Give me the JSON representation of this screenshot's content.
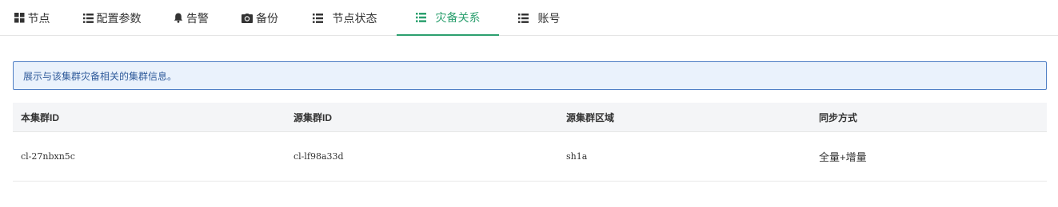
{
  "tabs": [
    {
      "label": "节点",
      "icon": "grid-icon"
    },
    {
      "label": "配置参数",
      "icon": "list-icon"
    },
    {
      "label": "告警",
      "icon": "bell-icon"
    },
    {
      "label": "备份",
      "icon": "camera-icon"
    },
    {
      "label": "节点状态",
      "icon": "list-icon"
    },
    {
      "label": "灾备关系",
      "icon": "list-icon",
      "active": true
    },
    {
      "label": "账号",
      "icon": "list-icon"
    }
  ],
  "alert": {
    "text": "展示与该集群灾备相关的集群信息。"
  },
  "table": {
    "columns": [
      "本集群ID",
      "源集群ID",
      "源集群区域",
      "同步方式"
    ],
    "rows": [
      [
        "cl-27nbxn5c",
        "cl-lf98a33d",
        "sh1a",
        "全量+增量"
      ]
    ]
  },
  "colors": {
    "accent": "#2ca06f",
    "alert_border": "#4f7fc5",
    "alert_bg": "#eaf2fc"
  }
}
